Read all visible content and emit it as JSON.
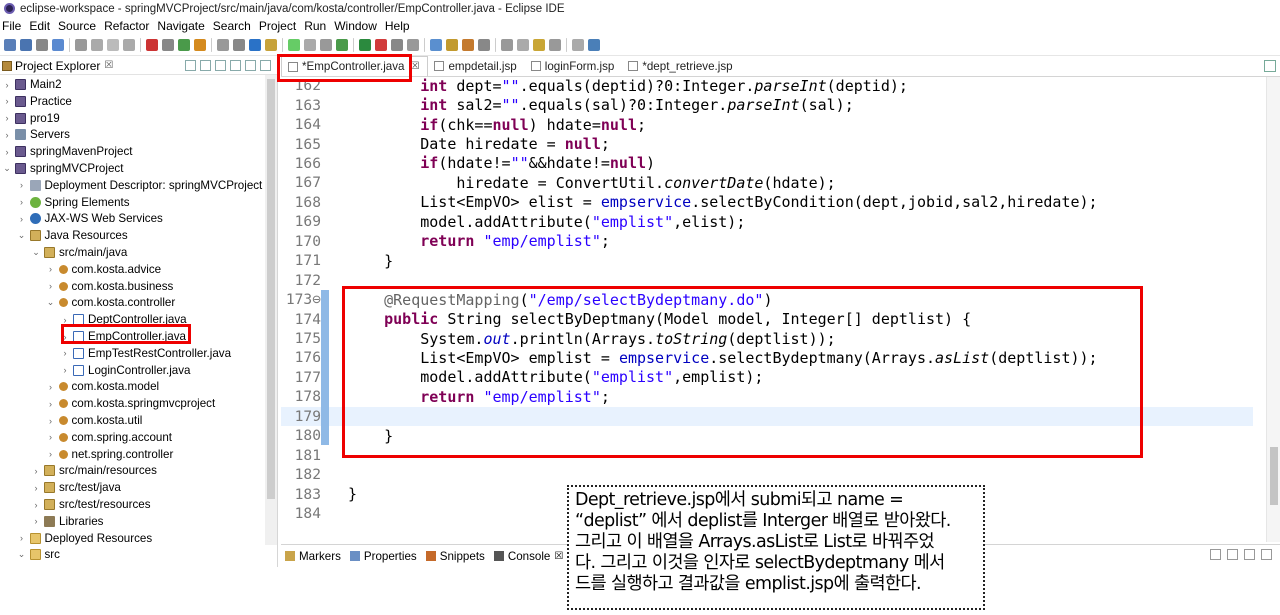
{
  "window": {
    "title": "eclipse-workspace - springMVCProject/src/main/java/com/kosta/controller/EmpController.java - Eclipse IDE"
  },
  "menu": [
    "File",
    "Edit",
    "Source",
    "Refactor",
    "Navigate",
    "Search",
    "Project",
    "Run",
    "Window",
    "Help"
  ],
  "explorer": {
    "title": "Project Explorer",
    "items": [
      {
        "label": "Main2",
        "indent": 0,
        "chev": "›",
        "icon": "proj"
      },
      {
        "label": "Practice",
        "indent": 0,
        "chev": "›",
        "icon": "proj"
      },
      {
        "label": "pro19",
        "indent": 0,
        "chev": "›",
        "icon": "proj"
      },
      {
        "label": "Servers",
        "indent": 0,
        "chev": "›",
        "icon": "srv"
      },
      {
        "label": "springMavenProject",
        "indent": 0,
        "chev": "›",
        "icon": "proj"
      },
      {
        "label": "springMVCProject",
        "indent": 0,
        "chev": "⌄",
        "icon": "proj"
      },
      {
        "label": "Deployment Descriptor: springMVCProject",
        "indent": 1,
        "chev": "›",
        "icon": "desc"
      },
      {
        "label": "Spring Elements",
        "indent": 1,
        "chev": "›",
        "icon": "spring"
      },
      {
        "label": "JAX-WS Web Services",
        "indent": 1,
        "chev": "›",
        "icon": "ws"
      },
      {
        "label": "Java Resources",
        "indent": 1,
        "chev": "⌄",
        "icon": "srcf"
      },
      {
        "label": "src/main/java",
        "indent": 2,
        "chev": "⌄",
        "icon": "srcf"
      },
      {
        "label": "com.kosta.advice",
        "indent": 3,
        "chev": "›",
        "icon": "pkg"
      },
      {
        "label": "com.kosta.business",
        "indent": 3,
        "chev": "›",
        "icon": "pkg"
      },
      {
        "label": "com.kosta.controller",
        "indent": 3,
        "chev": "⌄",
        "icon": "pkg"
      },
      {
        "label": "DeptController.java",
        "indent": 4,
        "chev": "›",
        "icon": "java"
      },
      {
        "label": "EmpController.java",
        "indent": 4,
        "chev": "›",
        "icon": "java"
      },
      {
        "label": "EmpTestRestController.java",
        "indent": 4,
        "chev": "›",
        "icon": "java"
      },
      {
        "label": "LoginController.java",
        "indent": 4,
        "chev": "›",
        "icon": "java"
      },
      {
        "label": "com.kosta.model",
        "indent": 3,
        "chev": "›",
        "icon": "pkg"
      },
      {
        "label": "com.kosta.springmvcproject",
        "indent": 3,
        "chev": "›",
        "icon": "pkg"
      },
      {
        "label": "com.kosta.util",
        "indent": 3,
        "chev": "›",
        "icon": "pkg"
      },
      {
        "label": "com.spring.account",
        "indent": 3,
        "chev": "›",
        "icon": "pkg"
      },
      {
        "label": "net.spring.controller",
        "indent": 3,
        "chev": "›",
        "icon": "pkg"
      },
      {
        "label": "src/main/resources",
        "indent": 2,
        "chev": "›",
        "icon": "srcf"
      },
      {
        "label": "src/test/java",
        "indent": 2,
        "chev": "›",
        "icon": "srcf"
      },
      {
        "label": "src/test/resources",
        "indent": 2,
        "chev": "›",
        "icon": "srcf"
      },
      {
        "label": "Libraries",
        "indent": 2,
        "chev": "›",
        "icon": "lib"
      },
      {
        "label": "Deployed Resources",
        "indent": 1,
        "chev": "›",
        "icon": "folder"
      },
      {
        "label": "src",
        "indent": 1,
        "chev": "⌄",
        "icon": "folder"
      }
    ]
  },
  "editor": {
    "tabs": [
      {
        "label": "*EmpController.java",
        "active": true,
        "close": "☒"
      },
      {
        "label": "empdetail.jsp",
        "active": false,
        "close": ""
      },
      {
        "label": "loginForm.jsp",
        "active": false,
        "close": ""
      },
      {
        "label": "*dept_retrieve.jsp",
        "active": false,
        "close": ""
      }
    ],
    "lines": [
      {
        "n": "162",
        "html": "        <span class='kw'>int</span> dept=<span class='str'>\"\"</span>.equals(deptid)?0:Integer.<span class='ital'>parseInt</span>(deptid);"
      },
      {
        "n": "163",
        "html": "        <span class='kw'>int</span> sal2=<span class='str'>\"\"</span>.equals(sal)?0:Integer.<span class='ital'>parseInt</span>(sal);"
      },
      {
        "n": "164",
        "html": "        <span class='kw'>if</span>(chk==<span class='kw'>null</span>) hdate=<span class='kw'>null</span>;"
      },
      {
        "n": "165",
        "html": "        Date hiredate = <span class='kw'>null</span>;"
      },
      {
        "n": "166",
        "html": "        <span class='kw'>if</span>(hdate!=<span class='str'>\"\"</span>&amp;&amp;hdate!=<span class='kw'>null</span>)"
      },
      {
        "n": "167",
        "html": "            hiredate = ConvertUtil.<span class='ital'>convertDate</span>(hdate);"
      },
      {
        "n": "168",
        "html": "        List&lt;EmpVO&gt; elist = <span class='fld'>empservice</span>.selectByCondition(dept,jobid,sal2,hiredate);"
      },
      {
        "n": "169",
        "html": "        model.addAttribute(<span class='str'>\"emplist\"</span>,elist);"
      },
      {
        "n": "170",
        "html": "        <span class='kw'>return</span> <span class='str'>\"emp/emplist\"</span>;"
      },
      {
        "n": "171",
        "html": "    }"
      },
      {
        "n": "172",
        "html": ""
      },
      {
        "n": "173⊖",
        "html": "    <span class='anno'>@RequestMapping</span>(<span class='str'>\"/emp/selectBydeptmany.do\"</span>)"
      },
      {
        "n": "174",
        "html": "    <span class='kw'>public</span> String selectByDeptmany(Model model, Integer[] deptlist) {"
      },
      {
        "n": "175",
        "html": "        System.<span class='fld ital'>out</span>.println(Arrays.<span class='ital'>toString</span>(deptlist));"
      },
      {
        "n": "176",
        "html": "        List&lt;EmpVO&gt; emplist = <span class='fld'>empservice</span>.selectBydeptmany(Arrays.<span class='ital'>asList</span>(deptlist));"
      },
      {
        "n": "177",
        "html": "        model.addAttribute(<span class='str'>\"emplist\"</span>,emplist);"
      },
      {
        "n": "178",
        "html": "        <span class='kw'>return</span> <span class='str'>\"emp/emplist\"</span>;"
      },
      {
        "n": "179",
        "html": ""
      },
      {
        "n": "180",
        "html": "    }"
      },
      {
        "n": "181",
        "html": ""
      },
      {
        "n": "182",
        "html": ""
      },
      {
        "n": "183",
        "html": "}"
      },
      {
        "n": "184",
        "html": ""
      }
    ]
  },
  "bottom": {
    "tabs": [
      "Markers",
      "Properties",
      "Snippets",
      "Console"
    ],
    "console_close": "☒"
  },
  "annotation": {
    "lines": [
      "Dept_retrieve.jsp에서 submi되고  name =",
      "“deplist” 에서 deplist를 Interger 배열로 받아왔다.",
      "그리고 이 배열을 Arrays.asList로 List로 바꿔주었",
      "다. 그리고 이것을 인자로 selectBydeptmany 메서",
      "드를 실행하고 결과값을 emplist.jsp에 출력한다."
    ]
  },
  "colors": {
    "highlight": "#e00000",
    "keyword": "#7f0055",
    "string": "#2a00ff",
    "field": "#0000c0"
  }
}
